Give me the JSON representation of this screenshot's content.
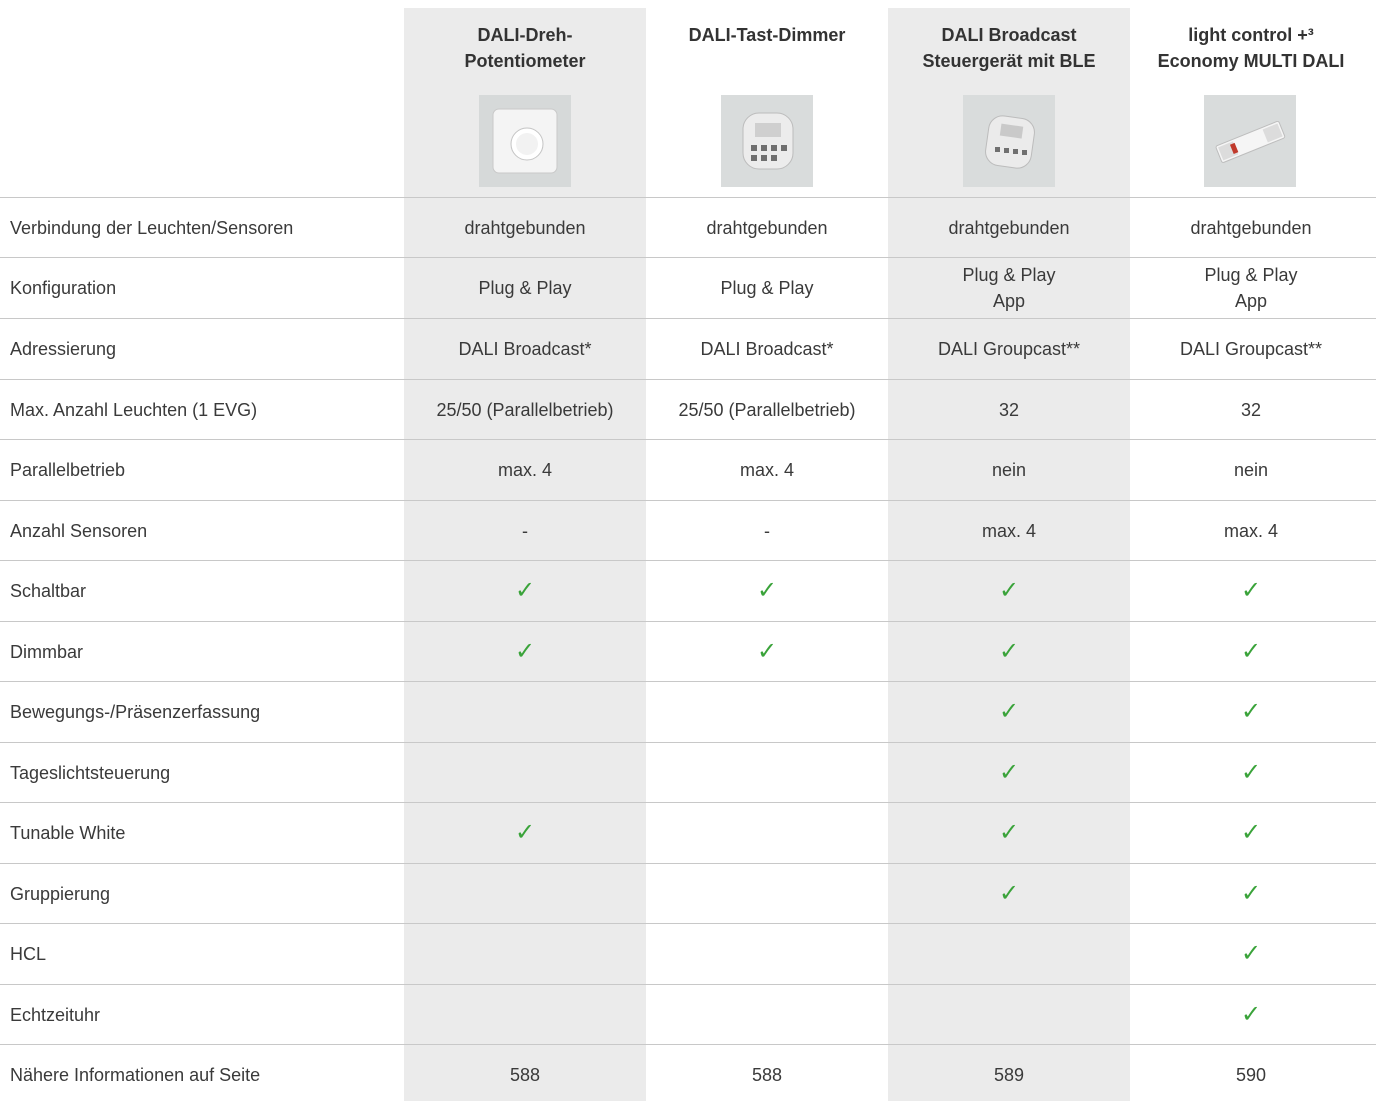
{
  "colors": {
    "check": "#3aa33a",
    "shade": "#ebebeb",
    "line": "#c8c8c8"
  },
  "products": [
    {
      "name": "DALI-Dreh-\nPotentiometer",
      "image_icon": "rotary-dimmer-image"
    },
    {
      "name": "DALI-Tast-Dimmer",
      "image_icon": "push-dimmer-module-image"
    },
    {
      "name": "DALI Broadcast\nSteuergerät mit BLE",
      "image_icon": "ble-controller-module-image"
    },
    {
      "name": "light control +³\nEconomy MULTI DALI",
      "image_icon": "multi-dali-controller-image"
    }
  ],
  "rows": [
    {
      "label": "Verbindung der Leuchten/Sensoren",
      "values": [
        "drahtgebunden",
        "drahtgebunden",
        "drahtgebunden",
        "drahtgebunden"
      ]
    },
    {
      "label": "Konfiguration",
      "values": [
        "Plug & Play",
        "Plug & Play",
        "Plug & Play\nApp",
        "Plug & Play\nApp"
      ]
    },
    {
      "label": "Adressierung",
      "values": [
        "DALI Broadcast*",
        "DALI Broadcast*",
        "DALI Groupcast**",
        "DALI Groupcast**"
      ]
    },
    {
      "label": "Max. Anzahl Leuchten (1 EVG)",
      "values": [
        "25/50 (Parallelbetrieb)",
        "25/50 (Parallelbetrieb)",
        "32",
        "32"
      ]
    },
    {
      "label": "Parallelbetrieb",
      "values": [
        "max. 4",
        "max. 4",
        "nein",
        "nein"
      ]
    },
    {
      "label": "Anzahl Sensoren",
      "values": [
        "-",
        "-",
        "max. 4",
        "max. 4"
      ]
    },
    {
      "label": "Schaltbar",
      "values": [
        "✓",
        "✓",
        "✓",
        "✓"
      ]
    },
    {
      "label": "Dimmbar",
      "values": [
        "✓",
        "✓",
        "✓",
        "✓"
      ]
    },
    {
      "label": "Bewegungs-/Präsenzerfassung",
      "values": [
        "",
        "",
        "✓",
        "✓"
      ]
    },
    {
      "label": "Tageslichtsteuerung",
      "values": [
        "",
        "",
        "✓",
        "✓"
      ]
    },
    {
      "label": "Tunable White",
      "values": [
        "✓",
        "",
        "✓",
        "✓"
      ]
    },
    {
      "label": "Gruppierung",
      "values": [
        "",
        "",
        "✓",
        "✓"
      ]
    },
    {
      "label": "HCL",
      "values": [
        "",
        "",
        "",
        "✓"
      ]
    },
    {
      "label": "Echtzeituhr",
      "values": [
        "",
        "",
        "",
        "✓"
      ]
    },
    {
      "label": "Nähere Informationen auf Seite",
      "values": [
        "588",
        "588",
        "589",
        "590"
      ]
    }
  ]
}
